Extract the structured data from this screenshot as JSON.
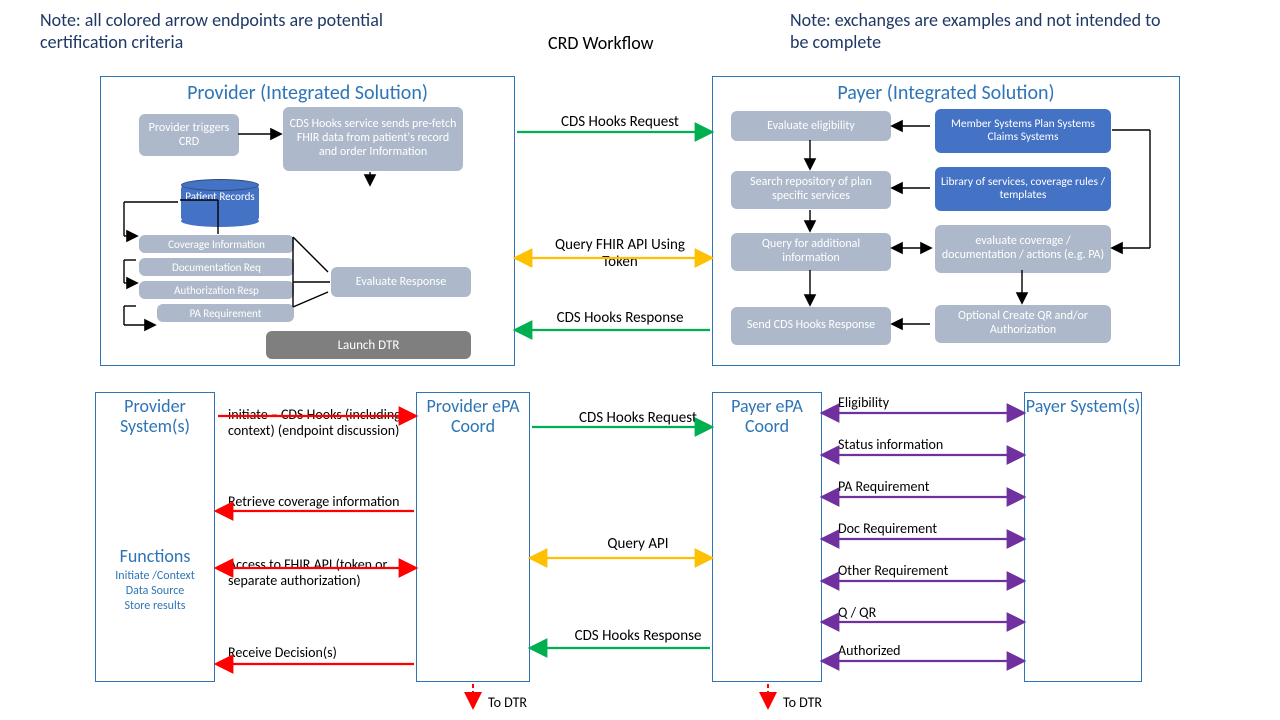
{
  "notes": {
    "left": "Note: all colored arrow endpoints are potential certification criteria",
    "right": "Note: exchanges are examples and not intended to be complete"
  },
  "title": "CRD Workflow",
  "provider_box": {
    "heading": "Provider (Integrated Solution)",
    "trigger": "Provider triggers CRD",
    "cds_hooks": "CDS Hooks service sends pre-fetch FHIR data from patient's record and order Information",
    "patient_records": "Patient Records",
    "coverage_info": "Coverage   Information",
    "doc_req": "Documentation Req",
    "auth_resp": "Authorization Resp",
    "pa_req": "PA Requirement",
    "eval_resp": "Evaluate Response",
    "launch_dtr": "Launch DTR"
  },
  "payer_box": {
    "heading": "Payer (Integrated Solution)",
    "eval_elig": "Evaluate eligibility",
    "member_sys": "Member Systems Plan Systems Claims Systems",
    "search_repo": "Search repository of plan specific services",
    "library": "Library of services, coverage rules / templates",
    "query_addl": "Query for additional information",
    "eval_cov": "evaluate coverage / documentation / actions (e.g. PA)",
    "send_resp": "Send CDS Hooks Response",
    "opt_qr": "Optional Create QR and/or Authorization"
  },
  "center_labels": {
    "req": "CDS Hooks Request",
    "query": "Query FHIR API Using Token",
    "resp": "CDS Hooks Response"
  },
  "bottom": {
    "prov_sys": "Provider System(s)",
    "prov_epa": "Provider ePA Coord",
    "payer_epa": "Payer ePA Coord",
    "payer_sys": "Payer System(s)",
    "functions_title": "Functions",
    "functions_items": "Initiate /Context\nData Source\nStore results",
    "initiate": "initiate – CDS Hooks (including context) (endpoint discussion)",
    "retrieve": "Retrieve coverage information",
    "access": "Access to FHIR API (token or separate authorization)",
    "receive": "Receive Decision(s)",
    "c_req": "CDS Hooks Request",
    "c_query": "Query API",
    "c_resp": "CDS Hooks Response",
    "elig": "Eligibility",
    "status": "Status information",
    "pa": "PA Requirement",
    "doc": "Doc Requirement",
    "other": "Other Requirement",
    "qqr": "Q / QR",
    "auth": "Authorized",
    "to_dtr": "To DTR"
  },
  "colors": {
    "green": "#00b050",
    "yellow": "#ffc000",
    "red": "#ff0000",
    "purple": "#7030a0",
    "black": "#000"
  }
}
